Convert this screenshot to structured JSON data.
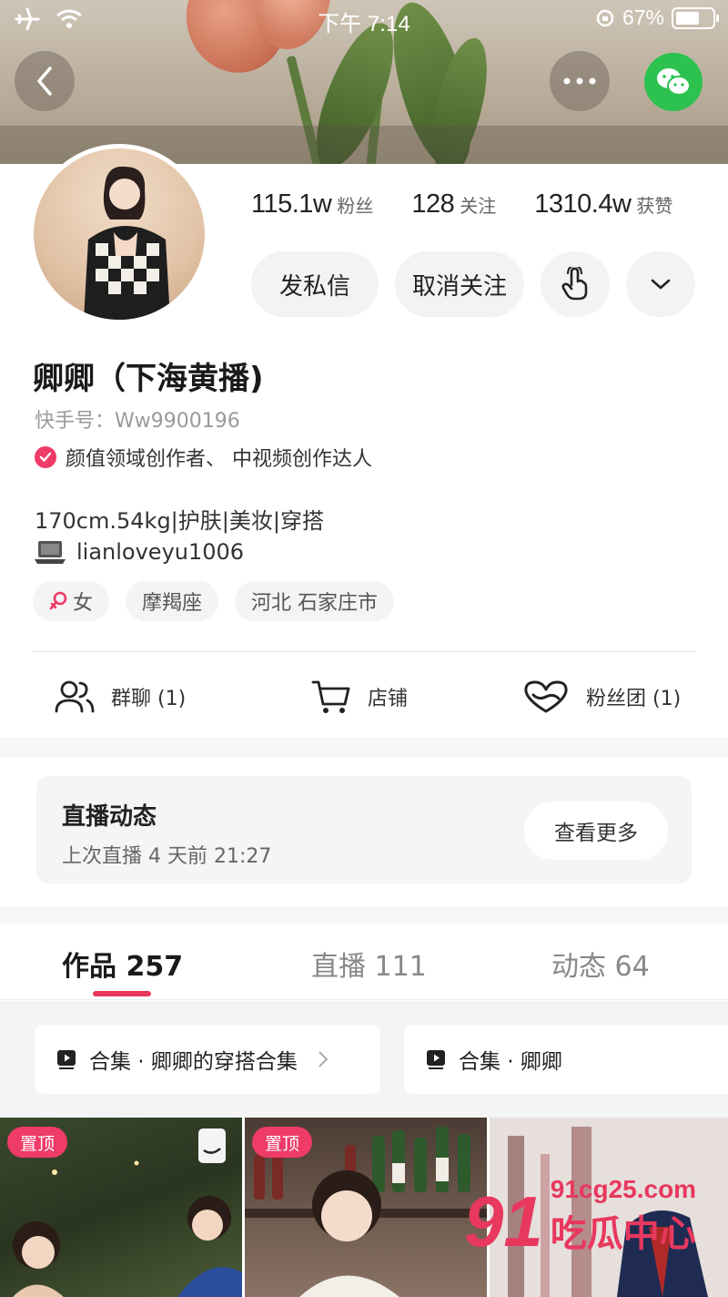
{
  "status_bar": {
    "time": "下午 7:14",
    "battery": "67%",
    "battery_level": 0.67
  },
  "profile": {
    "stats": [
      {
        "value": "115.1w",
        "label": "粉丝"
      },
      {
        "value": "128",
        "label": "关注"
      },
      {
        "value": "1310.4w",
        "label": "获赞"
      }
    ],
    "actions": {
      "message": "发私信",
      "unfollow": "取消关注"
    },
    "nickname": "卿卿（下海黄播)",
    "kuaishou_id": "快手号：Ww9900196",
    "certification": "颜值领域创作者、 中视频创作达人",
    "bio": "170cm.54kg|护肤|美妆|穿搭",
    "contact": "lianloveyu1006",
    "tags": [
      {
        "label": "女",
        "icon": "female-icon"
      },
      {
        "label": "摩羯座"
      },
      {
        "label": "河北 石家庄市"
      }
    ]
  },
  "quick_links": [
    {
      "label": "群聊 (1)",
      "icon": "users-icon"
    },
    {
      "label": "店铺",
      "icon": "cart-icon"
    },
    {
      "label": "粉丝团 (1)",
      "icon": "heart-icon"
    }
  ],
  "live": {
    "title": "直播动态",
    "subtitle": "上次直播 4 天前 21:27",
    "more": "查看更多"
  },
  "tabs": [
    {
      "label": "作品 257",
      "active": true
    },
    {
      "label": "直播 111",
      "active": false
    },
    {
      "label": "动态 64",
      "active": false
    }
  ],
  "collections": [
    {
      "label": "合集 · 卿卿的穿搭合集"
    },
    {
      "label": "合集 · 卿卿"
    }
  ],
  "videos": [
    {
      "badge": "置顶"
    },
    {
      "badge": "置顶"
    },
    {
      "badge": ""
    }
  ],
  "watermark": {
    "logo": "91",
    "site": "91cg25.com",
    "name": "吃瓜中心"
  },
  "colors": {
    "accent": "#e8385e",
    "wechat": "#2dc24f",
    "badge": "#ef3b67"
  }
}
